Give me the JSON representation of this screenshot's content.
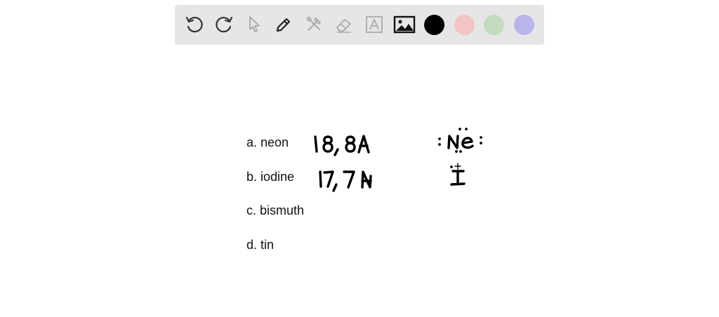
{
  "toolbar": {
    "tools": [
      "undo-icon",
      "redo-icon",
      "pointer-icon",
      "pen-icon",
      "tools-icon",
      "eraser-icon",
      "text-icon",
      "image-icon"
    ],
    "colors": [
      "#000000",
      "#f2c4c4",
      "#c3dcc0",
      "#b9b4ec"
    ]
  },
  "canvas": {
    "questions": [
      {
        "label": "a. neon",
        "answer": "18, 8A",
        "lewis": "Ne"
      },
      {
        "label": "b. iodine",
        "answer": "17, 7A",
        "lewis": "I"
      },
      {
        "label": "c. bismuth"
      },
      {
        "label": "d. tin"
      }
    ]
  }
}
